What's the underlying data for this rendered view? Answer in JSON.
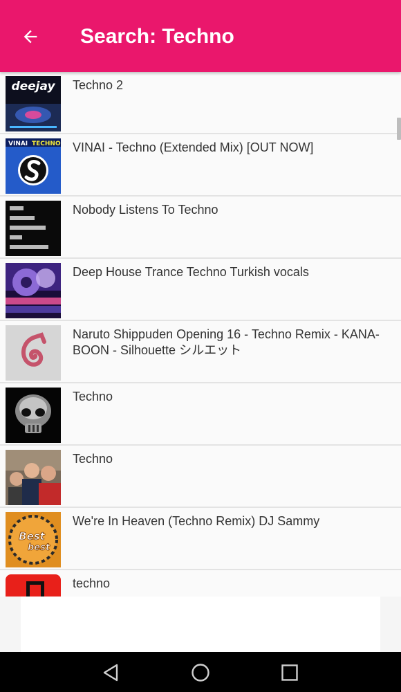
{
  "app_bar": {
    "title": "Search: Techno",
    "background": "#ea176c",
    "back_icon": "arrow-left-icon"
  },
  "results": [
    {
      "title": "Techno 2",
      "thumbnail": "deejay-artwork"
    },
    {
      "title": "VINAI - Techno (Extended Mix) [OUT NOW]",
      "thumbnail": "spinnin-records-artwork"
    },
    {
      "title": "Nobody Listens To Techno",
      "thumbnail": "black-text-artwork"
    },
    {
      "title": "Deep House Trance Techno Turkish vocals",
      "thumbnail": "dj-turntable-artwork"
    },
    {
      "title": "Naruto Shippuden Opening 16 - Techno Remix - KANA-BOON - Silhouette シルエット",
      "thumbnail": "leaf-village-symbol-artwork"
    },
    {
      "title": "Techno",
      "thumbnail": "chrome-skull-artwork"
    },
    {
      "title": "Techno",
      "thumbnail": "group-photo-artwork"
    },
    {
      "title": "We're In Heaven (Techno Remix) DJ Sammy",
      "thumbnail": "best-of-best-artwork"
    },
    {
      "title": "techno",
      "thumbnail": "red-music-note-artwork"
    }
  ],
  "nav_bar": {
    "back": "nav-back-icon",
    "home": "nav-home-icon",
    "recents": "nav-recents-icon"
  }
}
